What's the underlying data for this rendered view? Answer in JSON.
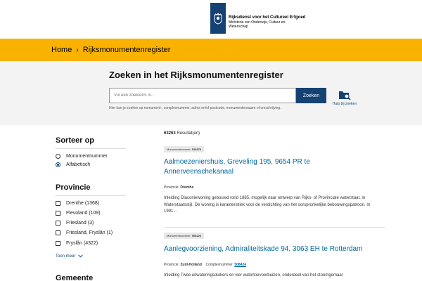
{
  "header": {
    "org_line1": "Rijksdienst voor het Cultureel Erfgoed",
    "org_line2": "Ministerie van Onderwijs, Cultuur en",
    "org_line3": "Wetenschap"
  },
  "breadcrumb": {
    "home": "Home",
    "separator": "›",
    "current": "Rijksmonumentenregister"
  },
  "search": {
    "title": "Zoeken in het Rijksmonumentenregister",
    "placeholder": "Vul een zoekterm in...",
    "button": "Zoeken",
    "hint": "Hier kan je zoeken op monument-, complexnummer, adres en/of postcode, monumentennaam of omschrijving.",
    "help": "Hulp bij zoeken"
  },
  "sidebar": {
    "sort_heading": "Sorteer op",
    "sort_options": [
      {
        "label": "Monumentnummer",
        "selected": false
      },
      {
        "label": "Alfabetisch",
        "selected": true
      }
    ],
    "province_heading": "Provincie",
    "provinces": [
      {
        "label": "Drenthe (1368)"
      },
      {
        "label": "Flevoland (109)"
      },
      {
        "label": "Friesland (3)"
      },
      {
        "label": "Friesland, Fryslân (1)"
      },
      {
        "label": "Fryslân (4322)"
      }
    ],
    "more": "Toon meer",
    "municipality_heading": "Gemeente"
  },
  "results": {
    "count": "63263",
    "count_suffix": "Resultat(en)",
    "items": [
      {
        "number_label": "Monumentnummer:",
        "number": "516979",
        "title": "Aalmoezeniershuis, Greveling 195, 9654 PR te Annerveenschekanaal",
        "province_label": "Provincie:",
        "province": "Drenthe",
        "description": "Inleiding Diaconiewoning gebouwd rond 1885, mogelijk naar ontwerp van Rijks- of Provinciale waterstaat, in Waterstaatsstijl. De woning is karakteristiek voor de verdichting van het oorspronkelijke bebouwingspatroon. In 1991..."
      },
      {
        "number_label": "Monumentnummer:",
        "number": "508223",
        "title": "Aanlegvoorziening, Admiraliteitskade 94, 3063 EH te Rotterdam",
        "province_label": "Provincie:",
        "province": "Zuid-Holland",
        "complex_label": "Complexnummer:",
        "complex": "508424",
        "description": "Inleiding Twee uitwateringsduikers en vier watertoevoerbuizen, onderdeel van het stoomgemaal"
      }
    ]
  },
  "colors": {
    "brand_blue": "#154273",
    "accent_yellow": "#f9b200",
    "link_blue": "#01689b"
  }
}
